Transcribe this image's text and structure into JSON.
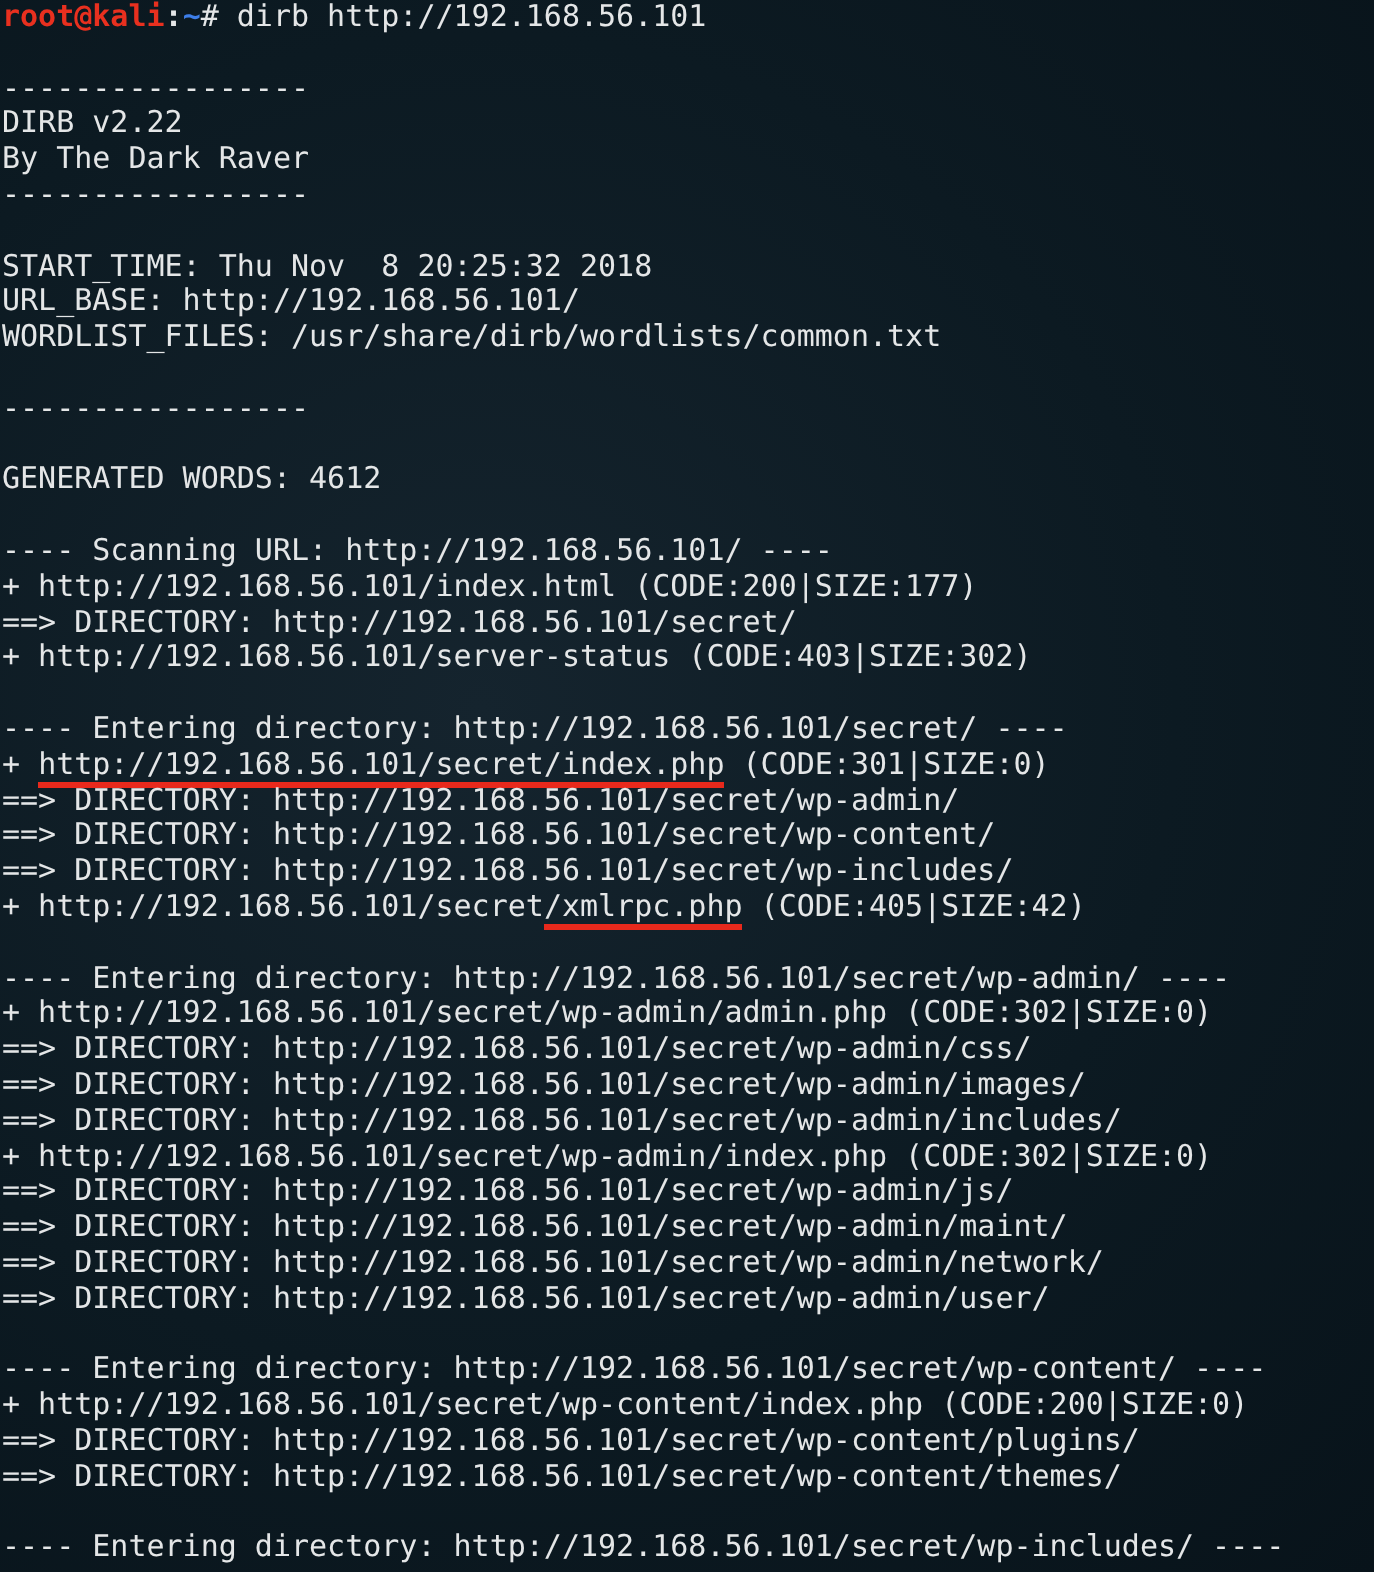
{
  "prompt": {
    "user": "root@kali",
    "separator": ":",
    "path": "~",
    "symbol": "#",
    "command": "dirb http://192.168.56.101"
  },
  "blocks": [
    {
      "lines": [
        {
          "segments": [
            {
              "text": "-----------------",
              "underlined": false
            }
          ]
        },
        {
          "segments": [
            {
              "text": "DIRB v2.22",
              "underlined": false
            }
          ]
        },
        {
          "segments": [
            {
              "text": "By The Dark Raver",
              "underlined": false
            }
          ]
        },
        {
          "segments": [
            {
              "text": "-----------------",
              "underlined": false
            }
          ]
        }
      ]
    },
    {
      "lines": [
        {
          "segments": [
            {
              "text": "START_TIME: Thu Nov  8 20:25:32 2018",
              "underlined": false
            }
          ]
        },
        {
          "segments": [
            {
              "text": "URL_BASE: http://192.168.56.101/",
              "underlined": false
            }
          ]
        },
        {
          "segments": [
            {
              "text": "WORDLIST_FILES: /usr/share/dirb/wordlists/common.txt",
              "underlined": false
            }
          ]
        }
      ]
    },
    {
      "lines": [
        {
          "segments": [
            {
              "text": "-----------------",
              "underlined": false
            }
          ]
        }
      ]
    },
    {
      "lines": [
        {
          "segments": [
            {
              "text": "GENERATED WORDS: 4612",
              "underlined": false
            }
          ]
        }
      ]
    },
    {
      "lines": [
        {
          "segments": [
            {
              "text": "---- Scanning URL: http://192.168.56.101/ ----",
              "underlined": false
            }
          ]
        },
        {
          "segments": [
            {
              "text": "+ http://192.168.56.101/index.html (CODE:200|SIZE:177)",
              "underlined": false
            }
          ]
        },
        {
          "segments": [
            {
              "text": "==> DIRECTORY: http://192.168.56.101/secret/",
              "underlined": false
            }
          ]
        },
        {
          "segments": [
            {
              "text": "+ http://192.168.56.101/server-status (CODE:403|SIZE:302)",
              "underlined": false
            }
          ]
        }
      ]
    },
    {
      "lines": [
        {
          "segments": [
            {
              "text": "---- Entering directory: http://192.168.56.101/secret/ ----",
              "underlined": false
            }
          ]
        },
        {
          "segments": [
            {
              "text": "+ ",
              "underlined": false
            },
            {
              "text": "http://192.168.56.101/secret/index.php",
              "underlined": true
            },
            {
              "text": " (CODE:301|SIZE:0)",
              "underlined": false
            }
          ]
        },
        {
          "segments": [
            {
              "text": "==> DIRECTORY: http://192.168.56.101/secret/wp-admin/",
              "underlined": false
            }
          ]
        },
        {
          "segments": [
            {
              "text": "==> DIRECTORY: http://192.168.56.101/secret/wp-content/",
              "underlined": false
            }
          ]
        },
        {
          "segments": [
            {
              "text": "==> DIRECTORY: http://192.168.56.101/secret/wp-includes/",
              "underlined": false
            }
          ]
        },
        {
          "segments": [
            {
              "text": "+ http://192.168.56.101/secret",
              "underlined": false
            },
            {
              "text": "/xmlrpc.php",
              "underlined": true
            },
            {
              "text": " (CODE:405|SIZE:42)",
              "underlined": false
            }
          ]
        }
      ]
    },
    {
      "lines": [
        {
          "segments": [
            {
              "text": "---- Entering directory: http://192.168.56.101/secret/wp-admin/ ----",
              "underlined": false
            }
          ]
        },
        {
          "segments": [
            {
              "text": "+ http://192.168.56.101/secret/wp-admin/admin.php (CODE:302|SIZE:0)",
              "underlined": false
            }
          ]
        },
        {
          "segments": [
            {
              "text": "==> DIRECTORY: http://192.168.56.101/secret/wp-admin/css/",
              "underlined": false
            }
          ]
        },
        {
          "segments": [
            {
              "text": "==> DIRECTORY: http://192.168.56.101/secret/wp-admin/images/",
              "underlined": false
            }
          ]
        },
        {
          "segments": [
            {
              "text": "==> DIRECTORY: http://192.168.56.101/secret/wp-admin/includes/",
              "underlined": false
            }
          ]
        },
        {
          "segments": [
            {
              "text": "+ http://192.168.56.101/secret/wp-admin/index.php (CODE:302|SIZE:0)",
              "underlined": false
            }
          ]
        },
        {
          "segments": [
            {
              "text": "==> DIRECTORY: http://192.168.56.101/secret/wp-admin/js/",
              "underlined": false
            }
          ]
        },
        {
          "segments": [
            {
              "text": "==> DIRECTORY: http://192.168.56.101/secret/wp-admin/maint/",
              "underlined": false
            }
          ]
        },
        {
          "segments": [
            {
              "text": "==> DIRECTORY: http://192.168.56.101/secret/wp-admin/network/",
              "underlined": false
            }
          ]
        },
        {
          "segments": [
            {
              "text": "==> DIRECTORY: http://192.168.56.101/secret/wp-admin/user/",
              "underlined": false
            }
          ]
        }
      ]
    },
    {
      "lines": [
        {
          "segments": [
            {
              "text": "---- Entering directory: http://192.168.56.101/secret/wp-content/ ----",
              "underlined": false
            }
          ]
        },
        {
          "segments": [
            {
              "text": "+ http://192.168.56.101/secret/wp-content/index.php (CODE:200|SIZE:0)",
              "underlined": false
            }
          ]
        },
        {
          "segments": [
            {
              "text": "==> DIRECTORY: http://192.168.56.101/secret/wp-content/plugins/",
              "underlined": false
            }
          ]
        },
        {
          "segments": [
            {
              "text": "==> DIRECTORY: http://192.168.56.101/secret/wp-content/themes/",
              "underlined": false
            }
          ]
        }
      ]
    },
    {
      "lines": [
        {
          "segments": [
            {
              "text": "---- Entering directory: http://192.168.56.101/secret/wp-includes/ ----",
              "underlined": false
            }
          ]
        }
      ]
    }
  ]
}
